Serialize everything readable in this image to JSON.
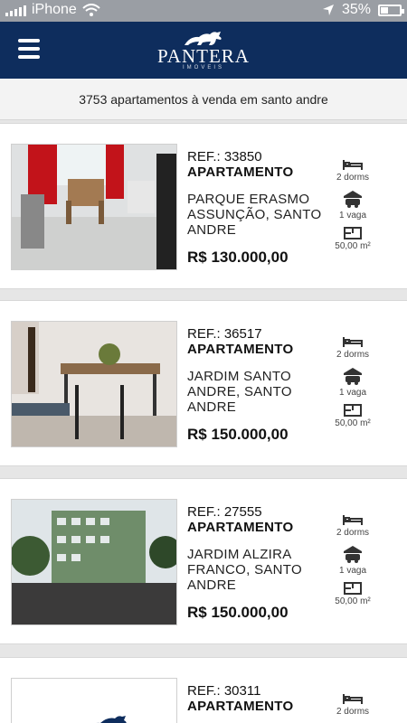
{
  "status": {
    "carrier": "iPhone",
    "battery": "35%",
    "battery_level": 0.35
  },
  "header": {
    "brand": "PANTERA",
    "sub": "IMÓVEIS"
  },
  "results": {
    "count_text": "3753 apartamentos à venda em santo andre"
  },
  "listings": [
    {
      "ref": "REF.: 33850",
      "type": "APARTAMENTO",
      "address": "PARQUE ERASMO ASSUNÇÃO, SANTO ANDRE",
      "price": "R$ 130.000,00",
      "dorms": "2 dorms",
      "vaga": "1 vaga",
      "area": "50,00 m²"
    },
    {
      "ref": "REF.: 36517",
      "type": "APARTAMENTO",
      "address": "JARDIM SANTO ANDRE, SANTO ANDRE",
      "price": "R$ 150.000,00",
      "dorms": "2 dorms",
      "vaga": "1 vaga",
      "area": "50,00 m²"
    },
    {
      "ref": "REF.: 27555",
      "type": "APARTAMENTO",
      "address": "JARDIM ALZIRA FRANCO, SANTO ANDRE",
      "price": "R$ 150.000,00",
      "dorms": "2 dorms",
      "vaga": "1 vaga",
      "area": "50,00 m²"
    },
    {
      "ref": "REF.: 30311",
      "type": "APARTAMENTO",
      "address": "",
      "price": "",
      "dorms": "2 dorms",
      "vaga": "",
      "area": ""
    }
  ],
  "icons": {
    "dorms": "bed-icon",
    "vaga": "car-icon",
    "area": "area-icon"
  },
  "colors": {
    "header_bg": "#0e2d5d",
    "page_bg": "#e6e6e6"
  }
}
